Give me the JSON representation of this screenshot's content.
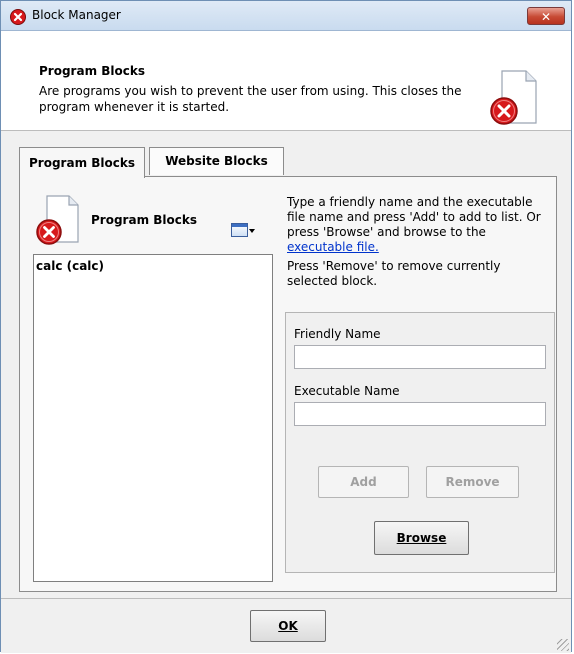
{
  "window": {
    "title": "Block Manager",
    "close_glyph": "✕"
  },
  "header": {
    "title": "Program Blocks",
    "description": "Are programs you wish to prevent the user from using.  This closes the program whenever it is started."
  },
  "tabs": [
    {
      "label": "Program Blocks",
      "active": true
    },
    {
      "label": "Website Blocks",
      "active": false
    }
  ],
  "list": {
    "header_label": "Program Blocks",
    "items": [
      "calc (calc)"
    ]
  },
  "instructions": {
    "part1": "Type a friendly name and the executable file name and press 'Add' to add to list.  Or press 'Browse' and browse to the ",
    "link": "executable file.",
    "part2": "Press 'Remove' to remove currently selected block."
  },
  "form": {
    "friendly_label": "Friendly Name",
    "friendly_value": "",
    "executable_label": "Executable Name",
    "executable_value": "",
    "add_label": "Add",
    "remove_label": "Remove",
    "browse_label": "Browse"
  },
  "footer": {
    "ok_label": "OK"
  },
  "colors": {
    "accent_red": "#d7191c",
    "link_blue": "#0033cc",
    "title_gradient_top": "#dfeaf6"
  },
  "icons": [
    "error-icon",
    "blocked-document-icon",
    "view-mode-icon",
    "dropdown-arrow-icon",
    "resize-grip-icon"
  ]
}
